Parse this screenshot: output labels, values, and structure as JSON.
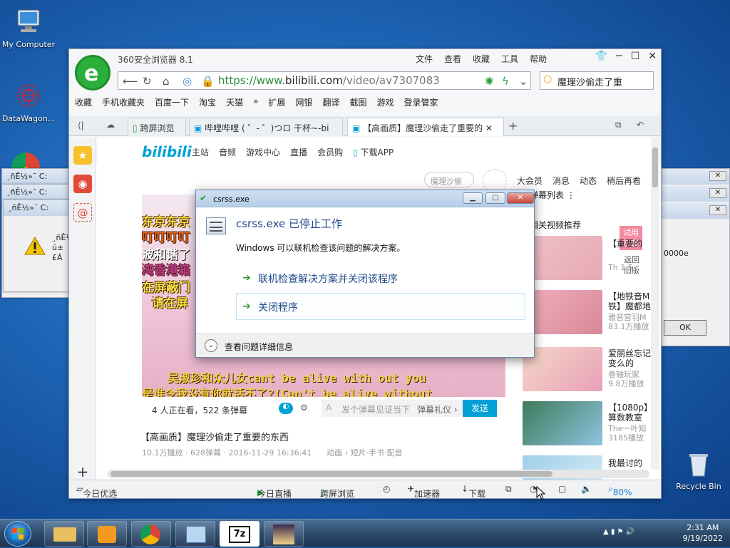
{
  "desktop": {
    "icons": [
      {
        "label": "My Computer"
      },
      {
        "label": "DataWagon..."
      },
      {
        "label": "Recycle Bin"
      }
    ]
  },
  "bg_windows": [
    {
      "title": "¸ñÊ½»¯ C:"
    },
    {
      "title": "¸ñÊ½»¯ C:"
    },
    {
      "title": "¸ñÊ½»¯ C:",
      "msg1": "¸ñÊ½",
      "msg2": "ú±£Á"
    },
    {
      "frag": "0000e",
      "ok": "OK"
    }
  ],
  "browser": {
    "app_title": "360安全浏览器 8.1",
    "menus": [
      "文件",
      "查看",
      "收藏",
      "工具",
      "帮助"
    ],
    "url_prefix": "https://www.",
    "url_host": "bilibili.com",
    "url_path": "/video/av7307083",
    "search_value": "魔理沙偷走了重",
    "favorites": [
      "收藏",
      "手机收藏夹",
      "百度一下",
      "淘宝",
      "天猫",
      "»",
      "扩展",
      "网银",
      "翻译",
      "截图",
      "游戏",
      "登录管家"
    ],
    "tabs": [
      {
        "label": "跨屏浏览"
      },
      {
        "label": "哔哩哔哩 ( ゜- ゜)つロ 干杯~-bi"
      },
      {
        "label": "【高画质】魔理沙偷走了重要的"
      }
    ]
  },
  "bilibili": {
    "logo": "bilibili",
    "nav": [
      "主站",
      "音频",
      "游戏中心",
      "直播",
      "会员购",
      "下载APP"
    ],
    "search_placeholder": "魔理沙偷",
    "top_right": [
      "大会员",
      "消息",
      "动态",
      "稍后再看"
    ],
    "video_lines": [
      "东京东京",
      "叮叮叮叮",
      "波和谐了",
      "湾香港箱",
      "在屏蔽门",
      "请在屏"
    ],
    "sub1": "吴淑珍和众儿女cant be alive with out you",
    "sub2": "是谁令我没有你就活不了?(Can't be alive without",
    "watching": "4 人正在看，522 条弹幕",
    "danmaku_placeholder": "发个弹幕见证当下",
    "danmaku_etiquette": "弹幕礼仪 ›",
    "send": "发送",
    "video_title": "【高画质】魔理沙偷走了重要的东西",
    "video_meta": "10.1万播放 · 628弹幕 · 2016-11-29 16:36:41",
    "video_breadcrumb": "动画 › 短片·手书·配音",
    "danmaku_list": "弹幕列表",
    "related_header": "相关视频推荐",
    "try_new": "试用\n反馈",
    "back_old": "返回\n旧版",
    "related": [
      {
        "title": "【重要的",
        "meta": "Th 1.5"
      },
      {
        "title": "【地铁音M铁】魔都地",
        "meta": "雅音宫羽M 83.1万播放"
      },
      {
        "title": "爱丽丝忘记变么的",
        "meta": "卷轴玩家 9.8万播放"
      },
      {
        "title": "【1080p】算数教室",
        "meta": "The一叶知 3185播放"
      },
      {
        "title": "我最讨的"
      }
    ]
  },
  "statusbar": {
    "today": "今日优选",
    "live": "今日直播",
    "cross": "跨屏浏览",
    "accel": "加速器",
    "download": "下载",
    "zoom": "80%"
  },
  "dialog": {
    "title": "csrss.exe",
    "heading": "csrss.exe 已停止工作",
    "subtext": "Windows 可以联机检查该问题的解决方案。",
    "option1": "联机检查解决方案并关闭该程序",
    "option2": "关闭程序",
    "details": "查看问题详细信息"
  },
  "taskbar": {
    "time": "2:31 AM",
    "date": "9/19/2022"
  },
  "colors": {
    "bili_blue": "#00a1d6",
    "dialog_heading": "#1e4b8a",
    "send_button": "#00a1d6"
  }
}
